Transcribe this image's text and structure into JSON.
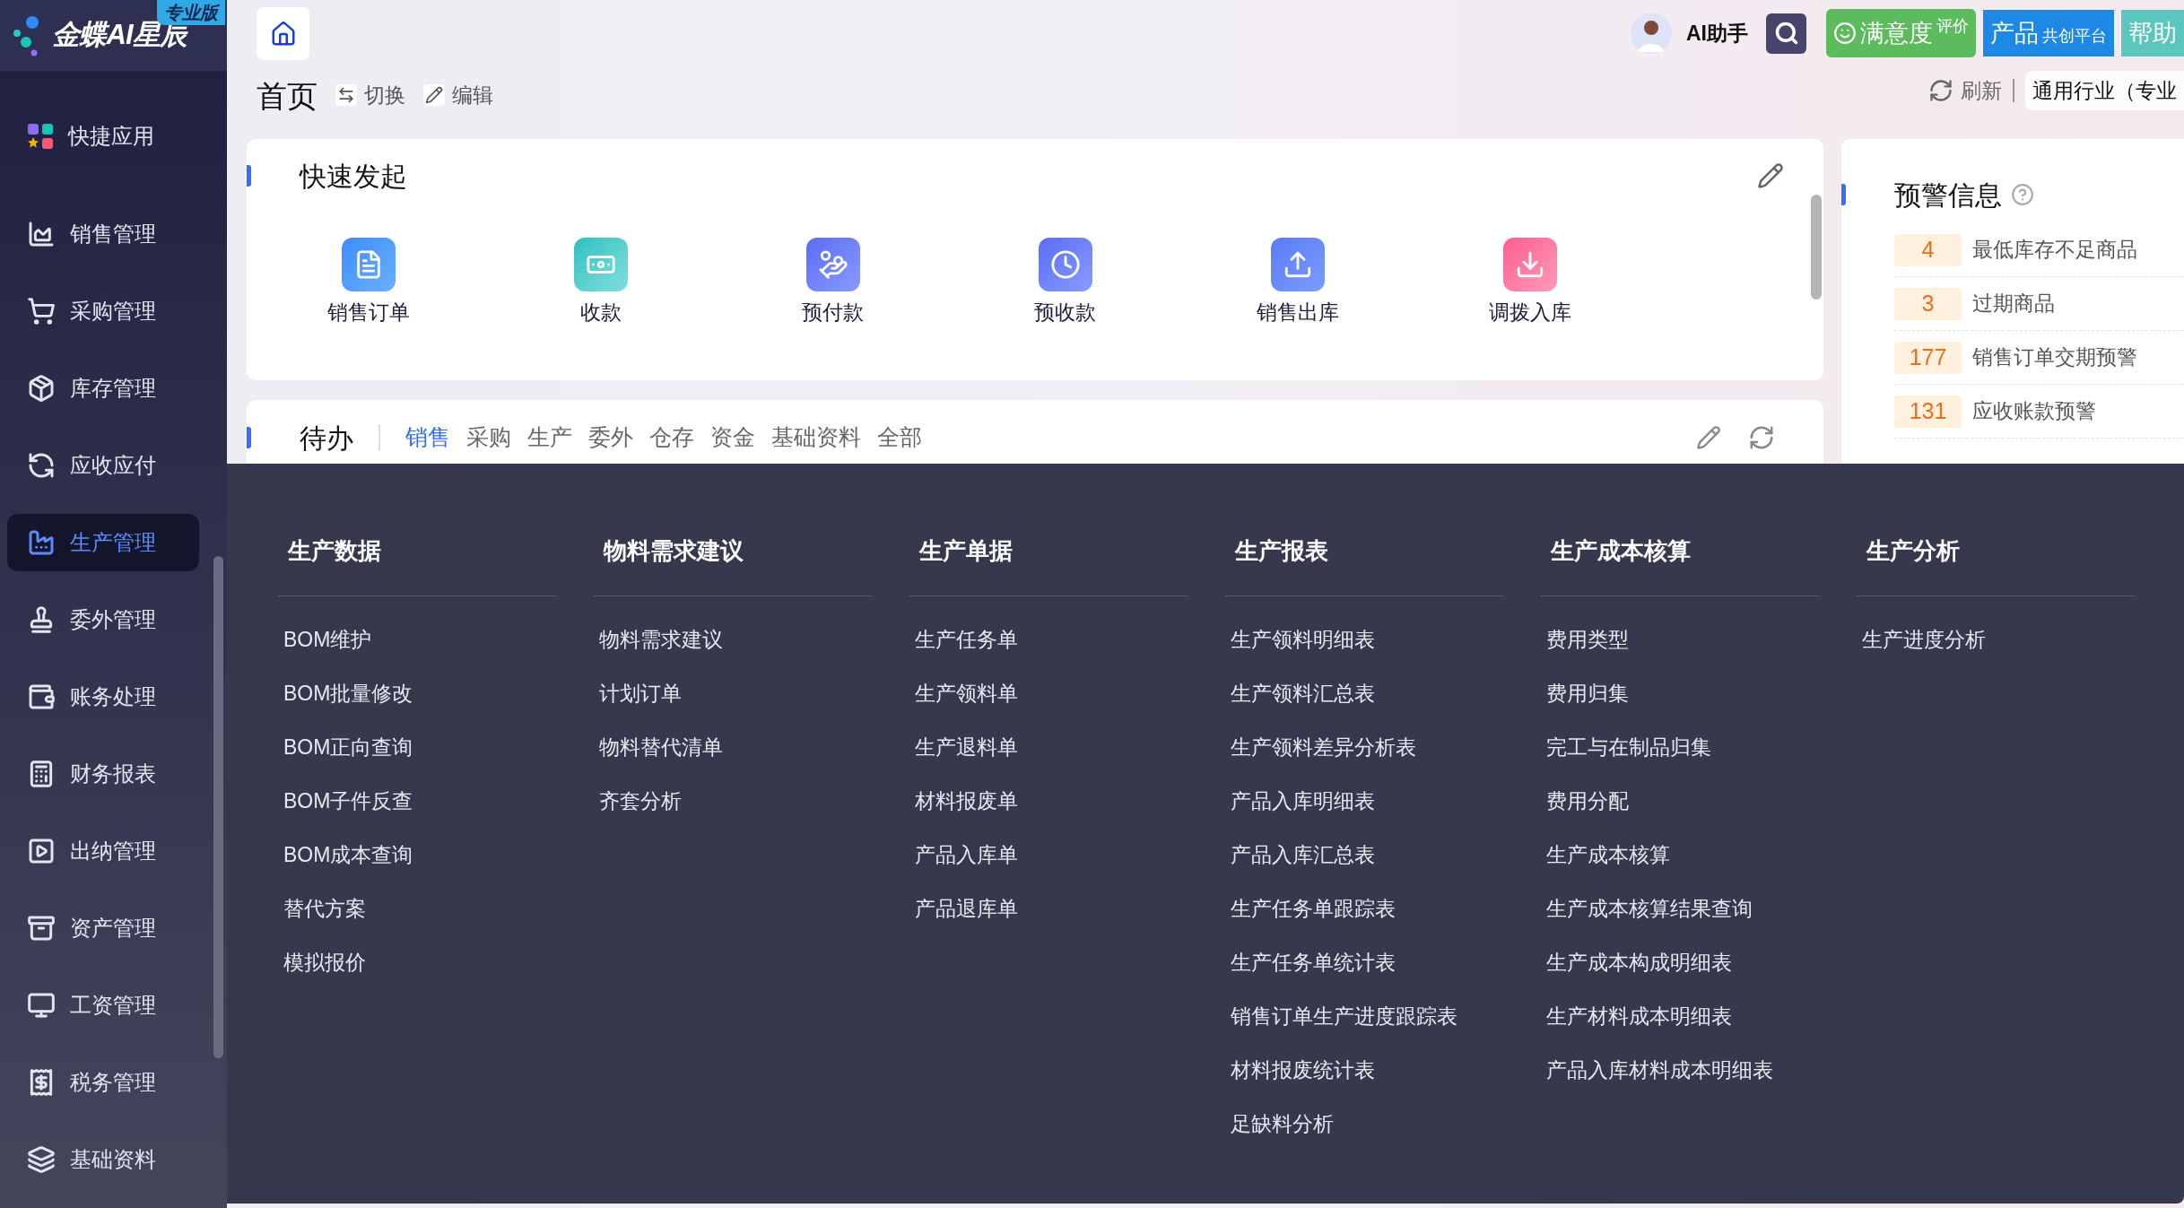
{
  "logo": {
    "name": "金蝶AI星辰",
    "badge": "专业版"
  },
  "sidebar": {
    "items": [
      {
        "label": "快捷应用",
        "selected": false
      },
      {
        "label": "销售管理",
        "selected": false
      },
      {
        "label": "采购管理",
        "selected": false
      },
      {
        "label": "库存管理",
        "selected": false
      },
      {
        "label": "应收应付",
        "selected": false
      },
      {
        "label": "生产管理",
        "selected": true
      },
      {
        "label": "委外管理",
        "selected": false
      },
      {
        "label": "账务处理",
        "selected": false
      },
      {
        "label": "财务报表",
        "selected": false
      },
      {
        "label": "出纳管理",
        "selected": false
      },
      {
        "label": "资产管理",
        "selected": false
      },
      {
        "label": "工资管理",
        "selected": false
      },
      {
        "label": "税务管理",
        "selected": false
      },
      {
        "label": "基础资料",
        "selected": false
      }
    ]
  },
  "header": {
    "assistant": "AI助手",
    "buttons": [
      {
        "kind": "feedback",
        "main": "满意度",
        "small": "评价"
      },
      {
        "kind": "platform",
        "main": "产品",
        "small": "共创平台"
      },
      {
        "kind": "help",
        "main": "帮助"
      }
    ]
  },
  "page": {
    "title": "首页",
    "actions": [
      {
        "kind": "switch",
        "label": "切换"
      },
      {
        "kind": "edit",
        "label": "编辑"
      }
    ],
    "refresh": "刷新",
    "industry": "通用行业（专业"
  },
  "quick_start": {
    "title": "快速发起",
    "items": [
      {
        "label": "销售订单"
      },
      {
        "label": "收款"
      },
      {
        "label": "预付款"
      },
      {
        "label": "预收款"
      },
      {
        "label": "销售出库"
      },
      {
        "label": "调拨入库"
      }
    ]
  },
  "todo": {
    "title": "待办",
    "tabs": [
      {
        "label": "销售",
        "selected": true
      },
      {
        "label": "采购",
        "selected": false
      },
      {
        "label": "生产",
        "selected": false
      },
      {
        "label": "委外",
        "selected": false
      },
      {
        "label": "仓存",
        "selected": false
      },
      {
        "label": "资金",
        "selected": false
      },
      {
        "label": "基础资料",
        "selected": false
      },
      {
        "label": "全部",
        "selected": false
      }
    ]
  },
  "alerts": {
    "title": "预警信息",
    "items": [
      {
        "count": "4",
        "label": "最低库存不足商品"
      },
      {
        "count": "3",
        "label": "过期商品"
      },
      {
        "count": "177",
        "label": "销售订单交期预警"
      },
      {
        "count": "131",
        "label": "应收账款预警"
      }
    ]
  },
  "menu": {
    "columns": [
      {
        "heading": "生产数据",
        "items": [
          "BOM维护",
          "BOM批量修改",
          "BOM正向查询",
          "BOM子件反查",
          "BOM成本查询",
          "替代方案",
          "模拟报价"
        ]
      },
      {
        "heading": "物料需求建议",
        "items": [
          "物料需求建议",
          "计划订单",
          "物料替代清单",
          "齐套分析"
        ]
      },
      {
        "heading": "生产单据",
        "items": [
          "生产任务单",
          "生产领料单",
          "生产退料单",
          "材料报废单",
          "产品入库单",
          "产品退库单"
        ]
      },
      {
        "heading": "生产报表",
        "items": [
          "生产领料明细表",
          "生产领料汇总表",
          "生产领料差异分析表",
          "产品入库明细表",
          "产品入库汇总表",
          "生产任务单跟踪表",
          "生产任务单统计表",
          "销售订单生产进度跟踪表",
          "材料报废统计表",
          "足缺料分析"
        ]
      },
      {
        "heading": "生产成本核算",
        "items": [
          "费用类型",
          "费用归集",
          "完工与在制品归集",
          "费用分配",
          "生产成本核算",
          "生产成本核算结果查询",
          "生产成本构成明细表",
          "生产材料成本明细表",
          "产品入库材料成本明细表"
        ]
      },
      {
        "heading": "生产分析",
        "items": [
          "生产进度分析"
        ]
      }
    ]
  }
}
